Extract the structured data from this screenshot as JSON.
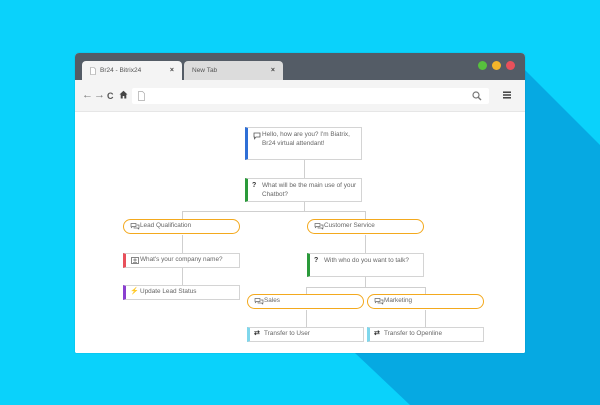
{
  "colors": {
    "background": "#0ad2fb",
    "titlebar": "#545c66",
    "accent_blue": "#2f6fd6",
    "accent_green": "#2a9a3a",
    "accent_red": "#e8505b",
    "accent_purple": "#8a3fd0",
    "accent_cyan": "#7fd7ec",
    "accent_orange": "#f3a91e"
  },
  "browser": {
    "tabs": [
      {
        "label": "Br24 - Bitrix24",
        "close": "×",
        "active": true
      },
      {
        "label": "New Tab",
        "close": "×",
        "active": false
      }
    ],
    "window_controls": [
      "green",
      "yellow",
      "red"
    ],
    "nav": {
      "back": "←",
      "forward": "→",
      "reload": "C",
      "home_icon": "home-icon"
    },
    "url": "",
    "search_icon": "magnifier-icon",
    "menu_icon": "hamburger-icon"
  },
  "flow": {
    "greeting": {
      "icon": "speech-bubble-icon",
      "text": "Hello, how are you? I'm Biatrix, Br24 virtual attendant!"
    },
    "question_main": {
      "icon": "?",
      "text": "What will be the main use of your Chatbot?"
    },
    "lead_qualification": {
      "icon": "chat-icon",
      "text": "Lead Qualification"
    },
    "customer_service": {
      "icon": "chat-icon",
      "text": "Customer Service"
    },
    "company_name": {
      "icon": "?",
      "text": "What's your company name?"
    },
    "update_lead": {
      "icon": "⚡",
      "text": "Update Lead Status"
    },
    "talk_question": {
      "icon": "?",
      "text": "With who do you want to talk?"
    },
    "sales": {
      "icon": "chat-icon",
      "text": "Sales"
    },
    "marketing": {
      "icon": "chat-icon",
      "text": "Marketing"
    },
    "transfer_user": {
      "icon": "⇄",
      "text": "Transfer to User"
    },
    "transfer_openline": {
      "icon": "⇄",
      "text": "Transfer to Openline"
    }
  }
}
